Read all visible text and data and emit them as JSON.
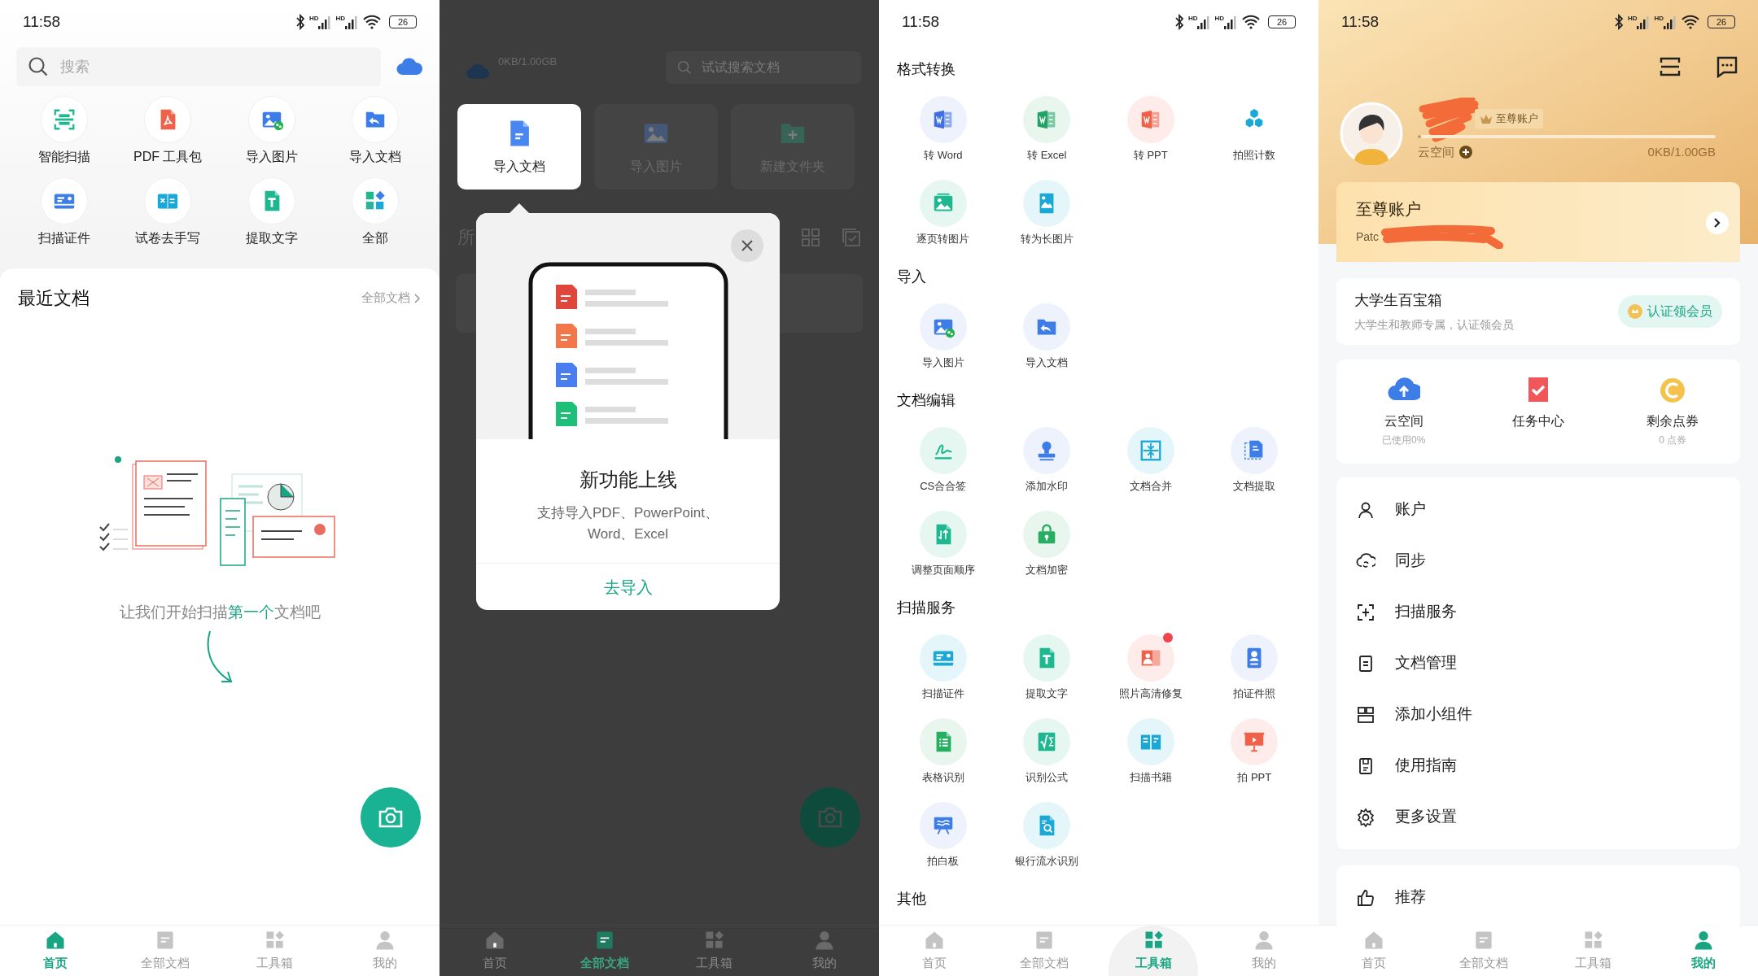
{
  "home_screen": {
    "status_bar": {
      "time": "11:58",
      "network": [
        "HD",
        "HD"
      ],
      "battery": "26"
    },
    "search": {
      "placeholder": "搜索"
    },
    "shortcuts": [
      {
        "label": "智能扫描",
        "kind": "scan"
      },
      {
        "label": "PDF 工具包",
        "kind": "pdf"
      },
      {
        "label": "导入图片",
        "kind": "image_chat"
      },
      {
        "label": "导入文档",
        "kind": "folder"
      },
      {
        "label": "扫描证件",
        "kind": "card"
      },
      {
        "label": "试卷去手写",
        "kind": "exam"
      },
      {
        "label": "提取文字",
        "kind": "text"
      },
      {
        "label": "全部",
        "kind": "grid"
      }
    ],
    "recent": {
      "title": "最近文档",
      "link": "全部文档"
    },
    "empty_state": {
      "before": "让我们开始扫描",
      "highlight": "第一个",
      "after": "文档吧"
    },
    "bottom_nav": [
      {
        "label": "首页",
        "kind": "home",
        "selected": true
      },
      {
        "label": "全部文档",
        "kind": "doc",
        "selected": false
      },
      {
        "label": "工具箱",
        "kind": "grid",
        "selected": false
      },
      {
        "label": "我的",
        "kind": "person",
        "selected": false
      }
    ]
  },
  "documents_screen": {
    "storage": "0KB/1.00GB",
    "search": {
      "placeholder": "试试搜索文档"
    },
    "actions": [
      {
        "label": "导入文档",
        "kind": "doc",
        "spotlighted": true
      },
      {
        "label": "导入图片",
        "kind": "image",
        "spotlighted": false
      },
      {
        "label": "新建文件夹",
        "kind": "newfolder",
        "spotlighted": false
      }
    ],
    "section_title": "所",
    "popup": {
      "title": "新功能上线",
      "description": "支持导入PDF、PowerPoint、Word、Excel",
      "action": "去导入"
    },
    "bottom_nav": [
      {
        "label": "首页",
        "kind": "home",
        "selected": false
      },
      {
        "label": "全部文档",
        "kind": "doc",
        "selected": true
      },
      {
        "label": "工具箱",
        "kind": "grid",
        "selected": false
      },
      {
        "label": "我的",
        "kind": "person",
        "selected": false
      }
    ]
  },
  "toolbox_screen": {
    "status_bar": {
      "time": "11:58",
      "network": [
        "HD",
        "HD"
      ],
      "battery": "26"
    },
    "sections": [
      {
        "title": "格式转换",
        "items": [
          {
            "label": "转 Word",
            "kind": "word"
          },
          {
            "label": "转 Excel",
            "kind": "excel"
          },
          {
            "label": "转 PPT",
            "kind": "ppt"
          },
          {
            "label": "拍照计数",
            "kind": "hex"
          },
          {
            "label": "逐页转图片",
            "kind": "pages"
          },
          {
            "label": "转为长图片",
            "kind": "longimage"
          }
        ]
      },
      {
        "title": "导入",
        "items": [
          {
            "label": "导入图片",
            "kind": "image_chat"
          },
          {
            "label": "导入文档",
            "kind": "folder"
          }
        ]
      },
      {
        "title": "文档编辑",
        "items": [
          {
            "label": "CS合合签",
            "kind": "sign"
          },
          {
            "label": "添加水印",
            "kind": "stamp"
          },
          {
            "label": "文档合并",
            "kind": "merge"
          },
          {
            "label": "文档提取",
            "kind": "extract"
          },
          {
            "label": "调整页面顺序",
            "kind": "reorder"
          },
          {
            "label": "文档加密",
            "kind": "lock"
          }
        ]
      },
      {
        "title": "扫描服务",
        "items": [
          {
            "label": "扫描证件",
            "kind": "card2",
            "badge": false
          },
          {
            "label": "提取文字",
            "kind": "text",
            "badge": false
          },
          {
            "label": "照片高清修复",
            "kind": "photo_fix",
            "badge": true
          },
          {
            "label": "拍证件照",
            "kind": "portrait",
            "badge": false
          },
          {
            "label": "表格识别",
            "kind": "table",
            "badge": false
          },
          {
            "label": "识别公式",
            "kind": "formula",
            "badge": false
          },
          {
            "label": "扫描书籍",
            "kind": "bookscan",
            "badge": false
          },
          {
            "label": "拍 PPT",
            "kind": "screen",
            "badge": false
          },
          {
            "label": "拍白板",
            "kind": "whiteboard",
            "badge": false
          },
          {
            "label": "银行流水识别",
            "kind": "searchdoc",
            "badge": false
          }
        ]
      },
      {
        "title": "其他"
      }
    ],
    "bottom_nav": [
      {
        "label": "首页",
        "kind": "home",
        "selected": false,
        "pressed": false
      },
      {
        "label": "全部文档",
        "kind": "doc",
        "selected": false,
        "pressed": false
      },
      {
        "label": "工具箱",
        "kind": "grid",
        "selected": true,
        "pressed": true
      },
      {
        "label": "我的",
        "kind": "person",
        "selected": false,
        "pressed": false
      }
    ]
  },
  "profile_screen": {
    "status_bar": {
      "time": "11:58",
      "network": [
        "HD",
        "HD"
      ],
      "battery": "26"
    },
    "membership_badge": "至尊账户",
    "cloud_label": "云空间",
    "storage": "0KB/1.00GB",
    "storage_bar": {
      "level": 0.01
    },
    "vip_card": {
      "title": "至尊账户",
      "subtitle": "Patc"
    },
    "student_card": {
      "title": "大学生百宝箱",
      "subtitle": "大学生和教师专属，认证领会员",
      "button": "认证领会员"
    },
    "stats": [
      {
        "label": "云空间",
        "sub": "已使用0%",
        "kind": "cloud"
      },
      {
        "label": "任务中心",
        "kind": "task"
      },
      {
        "label": "剩余点券",
        "sub": "0 点券",
        "kind": "coin"
      }
    ],
    "menu": [
      {
        "label": "账户",
        "kind": "person"
      },
      {
        "label": "同步",
        "kind": "sync"
      },
      {
        "label": "扫描服务",
        "kind": "scan"
      },
      {
        "label": "文档管理",
        "kind": "doc"
      },
      {
        "label": "添加小组件",
        "kind": "widget"
      },
      {
        "label": "使用指南",
        "kind": "guide"
      },
      {
        "label": "更多设置",
        "kind": "settings"
      }
    ],
    "more_menu": [
      {
        "label": "推荐",
        "kind": "thumb"
      }
    ],
    "bottom_nav": [
      {
        "label": "首页",
        "kind": "home",
        "selected": false
      },
      {
        "label": "全部文档",
        "kind": "doc",
        "selected": false
      },
      {
        "label": "工具箱",
        "kind": "grid",
        "selected": false
      },
      {
        "label": "我的",
        "kind": "person",
        "selected": true
      }
    ]
  }
}
